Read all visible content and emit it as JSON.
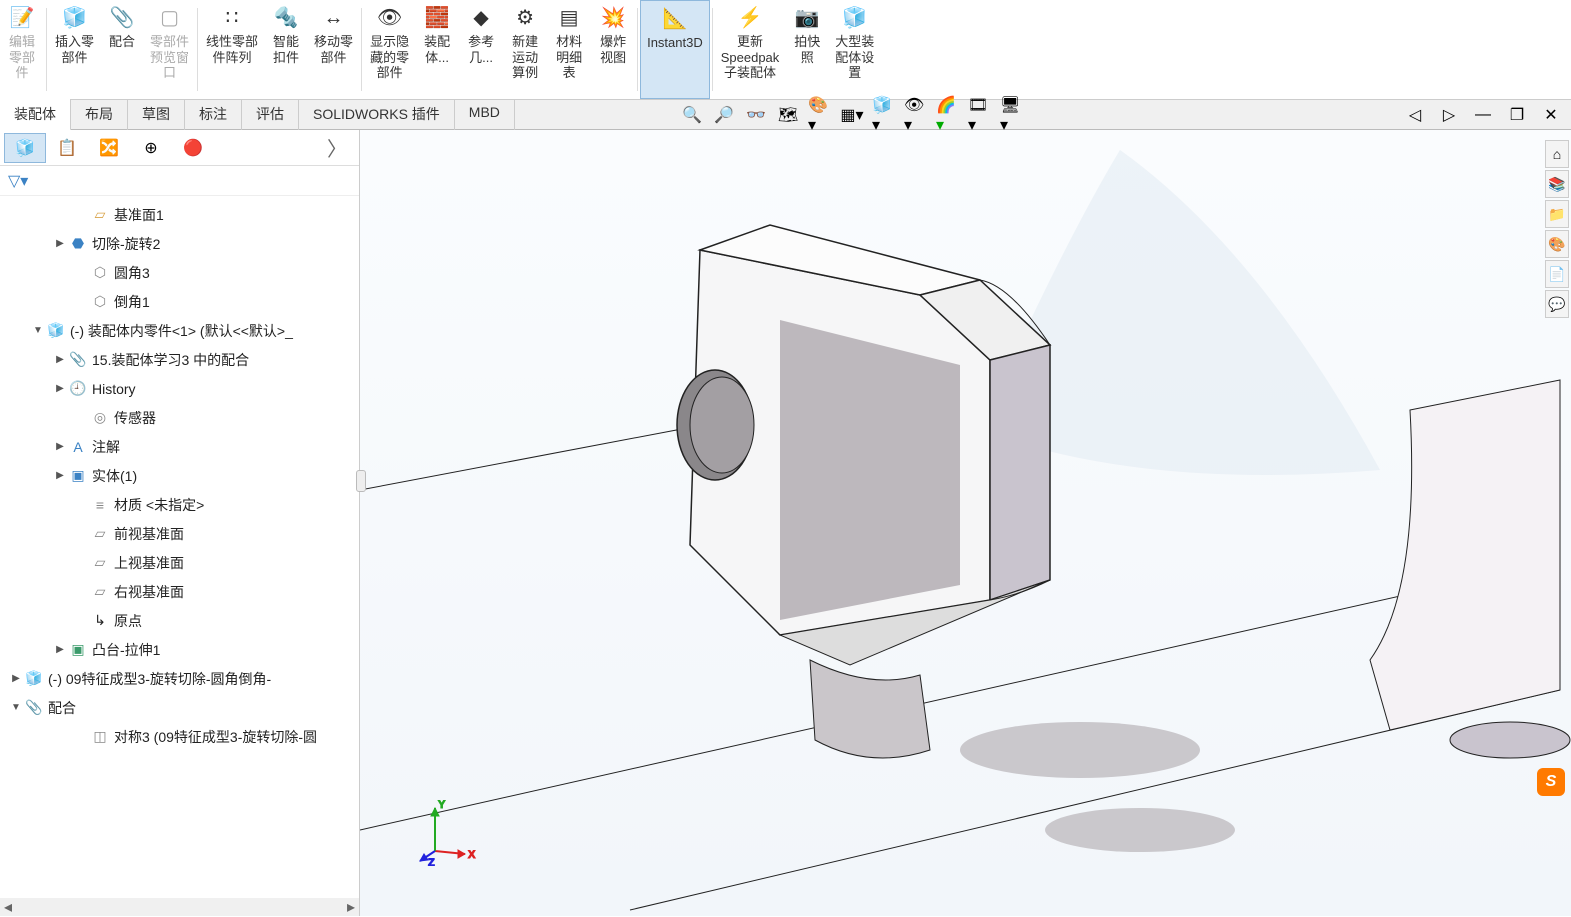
{
  "ribbon": [
    {
      "label": "编辑\n零部\n件",
      "icon": "📝",
      "disabled": true
    },
    {
      "label": "插入零\n部件",
      "icon": "🧊"
    },
    {
      "label": "配合",
      "icon": "📎"
    },
    {
      "label": "零部件\n预览窗\n口",
      "icon": "▢",
      "disabled": true
    },
    {
      "label": "线性零部\n件阵列",
      "icon": "∷"
    },
    {
      "label": "智能\n扣件",
      "icon": "🔩"
    },
    {
      "label": "移动零\n部件",
      "icon": "↔"
    },
    {
      "label": "显示隐\n藏的零\n部件",
      "icon": "👁"
    },
    {
      "label": "装配\n体...",
      "icon": "🧱"
    },
    {
      "label": "参考\n几...",
      "icon": "◆"
    },
    {
      "label": "新建\n运动\n算例",
      "icon": "⚙"
    },
    {
      "label": "材料\n明细\n表",
      "icon": "▤"
    },
    {
      "label": "爆炸\n视图",
      "icon": "💥"
    },
    {
      "label": "Instant3D",
      "icon": "📐",
      "active": true
    },
    {
      "label": "更新\nSpeedpak\n子装配体",
      "icon": "⚡"
    },
    {
      "label": "拍快\n照",
      "icon": "📷"
    },
    {
      "label": "大型装\n配体设\n置",
      "icon": "🧊"
    }
  ],
  "tabs": [
    "装配体",
    "布局",
    "草图",
    "标注",
    "评估",
    "SOLIDWORKS 插件",
    "MBD"
  ],
  "activeTab": 0,
  "tree": [
    {
      "indent": 3,
      "icon": "▱",
      "color": "#d9a44a",
      "label": "基准面1"
    },
    {
      "indent": 2,
      "arrow": "▶",
      "icon": "⬣",
      "color": "#3b82c4",
      "label": "切除-旋转2"
    },
    {
      "indent": 3,
      "icon": "⬡",
      "color": "#888",
      "label": "圆角3"
    },
    {
      "indent": 3,
      "icon": "⬡",
      "color": "#888",
      "label": "倒角1"
    },
    {
      "indent": 1,
      "arrow": "▼",
      "icon": "🧊",
      "color": "#d9a44a",
      "label": "(-) 装配体内零件<1> (默认<<默认>_"
    },
    {
      "indent": 2,
      "arrow": "▶",
      "icon": "📎",
      "color": "#3b82c4",
      "label": "15.装配体学习3 中的配合"
    },
    {
      "indent": 2,
      "arrow": "▶",
      "icon": "🕘",
      "color": "#888",
      "label": "History"
    },
    {
      "indent": 3,
      "icon": "◎",
      "color": "#888",
      "label": "传感器"
    },
    {
      "indent": 2,
      "arrow": "▶",
      "icon": "A",
      "color": "#3b82c4",
      "label": "注解"
    },
    {
      "indent": 2,
      "arrow": "▶",
      "icon": "▣",
      "color": "#3b82c4",
      "label": "实体(1)"
    },
    {
      "indent": 3,
      "icon": "≡",
      "color": "#888",
      "label": "材质 <未指定>"
    },
    {
      "indent": 3,
      "icon": "▱",
      "color": "#888",
      "label": "前视基准面"
    },
    {
      "indent": 3,
      "icon": "▱",
      "color": "#888",
      "label": "上视基准面"
    },
    {
      "indent": 3,
      "icon": "▱",
      "color": "#888",
      "label": "右视基准面"
    },
    {
      "indent": 3,
      "icon": "↳",
      "color": "#222",
      "label": "原点"
    },
    {
      "indent": 2,
      "arrow": "▶",
      "icon": "▣",
      "color": "#3b9b6b",
      "label": "凸台-拉伸1"
    },
    {
      "indent": 0,
      "arrow": "▶",
      "icon": "🧊",
      "color": "#d9a44a",
      "label": "(-) 09特征成型3-旋转切除-圆角倒角-"
    },
    {
      "indent": 0,
      "arrow": "▼",
      "icon": "📎",
      "color": "#3b82c4",
      "label": "配合"
    },
    {
      "indent": 3,
      "icon": "◫",
      "color": "#888",
      "label": "对称3 (09特征成型3-旋转切除-圆"
    }
  ],
  "triad": {
    "x": "X",
    "y": "Y",
    "z": "Z"
  },
  "sogou": "S"
}
